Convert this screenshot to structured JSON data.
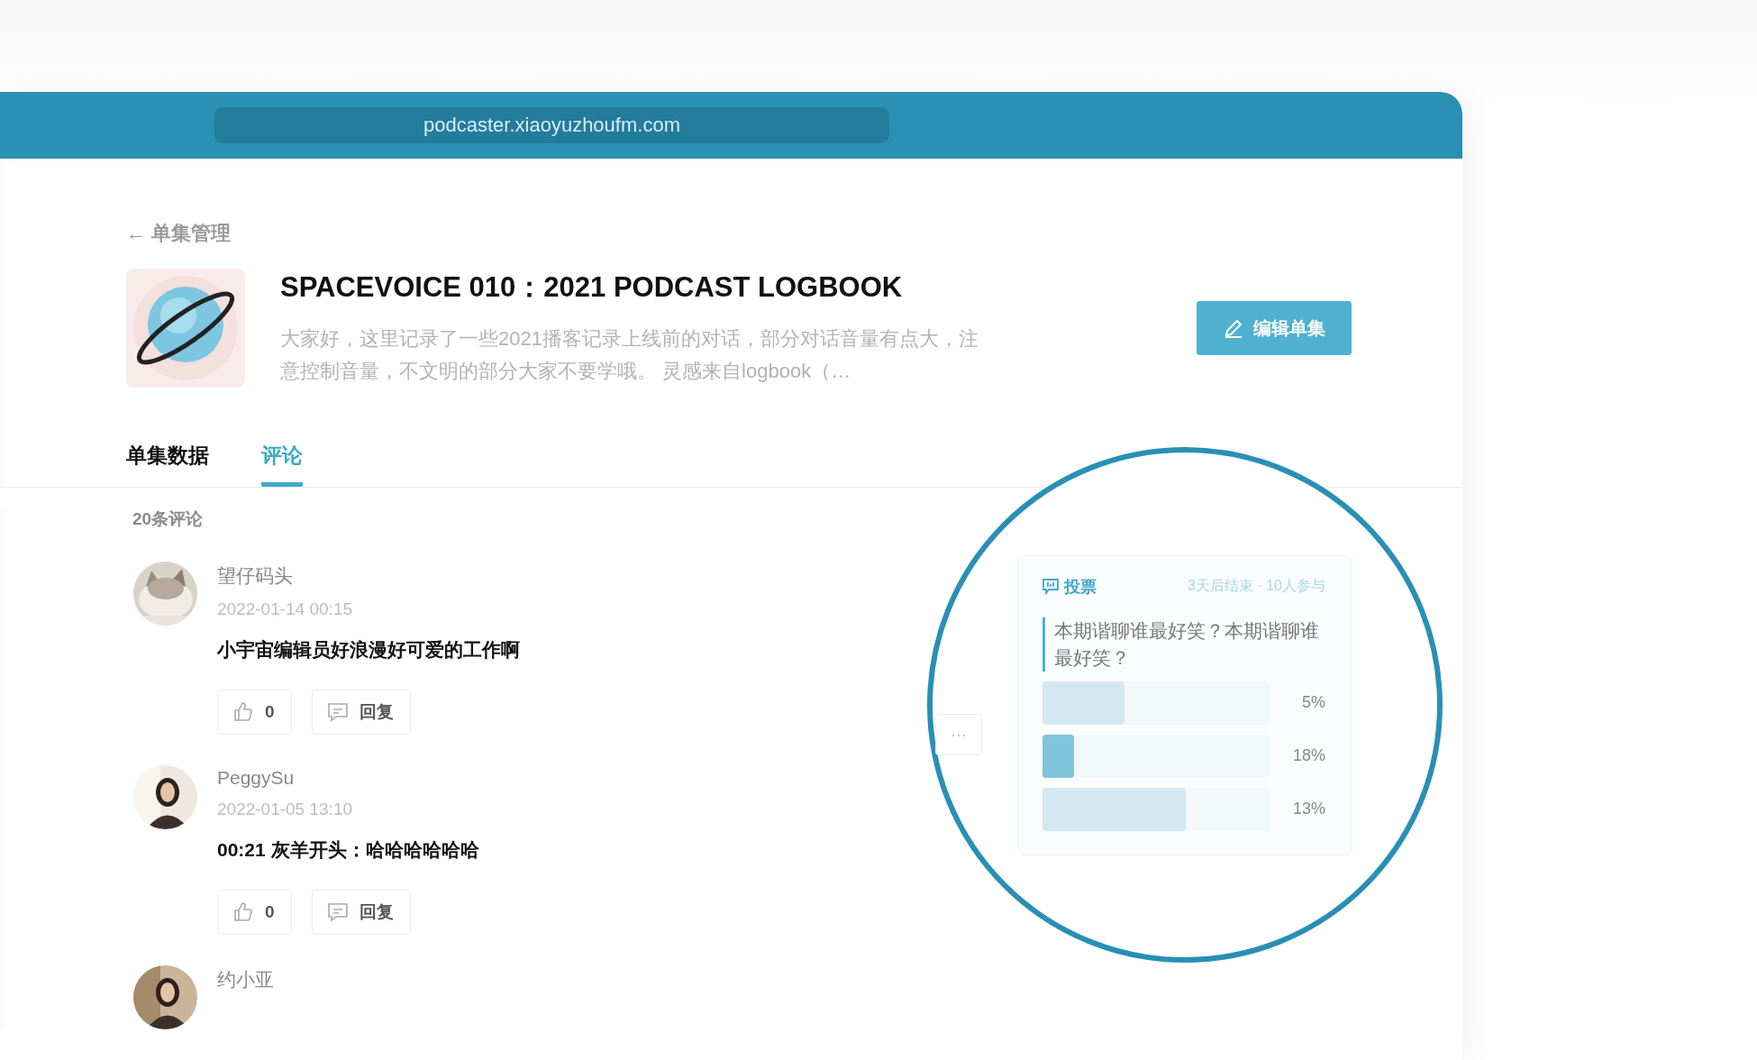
{
  "browser": {
    "url": "podcaster.xiaoyuzhoufm.com"
  },
  "back_link": {
    "arrow": "←",
    "label": "单集管理"
  },
  "episode": {
    "title": "SPACEVOICE 010：2021 PODCAST LOGBOOK",
    "description": "大家好，这里记录了一些2021播客记录上线前的对话，部分对话音量有点大，注意控制音量，不文明的部分大家不要学哦。 灵感来自logbook（…",
    "edit_button": "编辑单集"
  },
  "tabs": [
    {
      "label": "单集数据",
      "selected": false
    },
    {
      "label": "评论",
      "selected": true
    }
  ],
  "comment_count": "20条评论",
  "comments": [
    {
      "author": "望仔码头",
      "date": "2022-01-14 00:15",
      "text": "小宇宙编辑员好浪漫好可爱的工作啊",
      "likes": "0",
      "reply": "回复"
    },
    {
      "author": "PeggySu",
      "date": "2022-01-05 13:10",
      "text": "00:21 灰羊开头：哈哈哈哈哈哈",
      "likes": "0",
      "reply": "回复"
    },
    {
      "author": "约小亚"
    }
  ],
  "more_button": "···",
  "poll": {
    "label": "投票",
    "meta": "3天后结束 · 10人参与",
    "question": "本期谐聊谁最好笑？本期谐聊谁最好笑？",
    "options": [
      {
        "level": 0.36,
        "percent": "5%",
        "selected": false
      },
      {
        "level": 0.14,
        "percent": "18%",
        "selected": true
      },
      {
        "level": 0.63,
        "percent": "13%",
        "selected": false
      }
    ]
  }
}
